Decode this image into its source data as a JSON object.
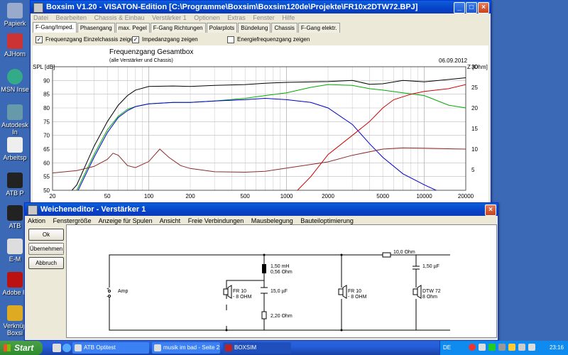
{
  "desktop": {
    "icons": [
      {
        "label": "Papierk"
      },
      {
        "label": "AJHorn"
      },
      {
        "label": "MSN Inse"
      },
      {
        "label": "Autodesk In"
      },
      {
        "label": "Arbeitsp"
      },
      {
        "label": "ATB P"
      },
      {
        "label": "ATB"
      },
      {
        "label": "E-M"
      },
      {
        "label": "Adobe R"
      },
      {
        "label": "Verknüp Boxsi"
      }
    ]
  },
  "boxsim": {
    "title": "Boxsim V1.20 - VISATON-Edition [C:\\Programme\\Boxsim\\Boxsim120de\\Projekte\\FR10x2DTW72.BPJ]",
    "menu": [
      "Datei",
      "Bearbeiten",
      "Chassis & Einbau",
      "Verstärker 1",
      "Optionen",
      "Extras",
      "Fenster",
      "Hilfe"
    ],
    "tabs": [
      "F-Gang/Imped.",
      "Phasengang",
      "max. Pegel",
      "F-Gang Richtungen",
      "Polarplots",
      "Bündelung",
      "Chassis",
      "F-Gang elektr."
    ],
    "active_tab": "F-Gang/Imped.",
    "checkboxes": [
      {
        "label": "Frequenzgang Einzelchassis zeigen",
        "checked": true
      },
      {
        "label": "Impedanzgang zeigen",
        "checked": true
      },
      {
        "label": "Energiefrequenzgang zeigen",
        "checked": false
      }
    ]
  },
  "chart_data": {
    "type": "line",
    "title": "Frequenzgang Gesamtbox",
    "subtitle": "(alle Verstärker und Chassis)",
    "date": "06.09.2012",
    "ylabel": "SPL [dB]",
    "y2label": "Z [Ohm]",
    "xscale": "log",
    "xlim": [
      20,
      20000
    ],
    "ylim": [
      50,
      95
    ],
    "y2lim": [
      0,
      30
    ],
    "xticks": [
      "20",
      "50",
      "100",
      "200",
      "500",
      "1000",
      "2000",
      "5000",
      "10000",
      "20000"
    ],
    "yticks": [
      "50",
      "55",
      "60",
      "65",
      "70",
      "75",
      "80",
      "85",
      "90"
    ],
    "y2ticks": [
      "5",
      "10",
      "15",
      "20",
      "25",
      "30"
    ],
    "grid": true,
    "series": [
      {
        "color": "#000000",
        "axis": "left",
        "points": [
          [
            20,
            42
          ],
          [
            30,
            52
          ],
          [
            40,
            66
          ],
          [
            50,
            75
          ],
          [
            60,
            81
          ],
          [
            70,
            84.5
          ],
          [
            80,
            86.5
          ],
          [
            100,
            87.8
          ],
          [
            150,
            88
          ],
          [
            200,
            87.8
          ],
          [
            300,
            88.2
          ],
          [
            500,
            88.5
          ],
          [
            700,
            89
          ],
          [
            1000,
            89.3
          ],
          [
            2000,
            89.6
          ],
          [
            3000,
            90
          ],
          [
            4000,
            88.6
          ],
          [
            5000,
            88.8
          ],
          [
            7000,
            90
          ],
          [
            10000,
            89.5
          ],
          [
            20000,
            91
          ]
        ]
      },
      {
        "color": "#00aa00",
        "axis": "left",
        "points": [
          [
            20,
            40
          ],
          [
            30,
            50
          ],
          [
            40,
            63
          ],
          [
            50,
            72
          ],
          [
            60,
            77
          ],
          [
            70,
            79.5
          ],
          [
            80,
            80.5
          ],
          [
            100,
            81.5
          ],
          [
            150,
            82
          ],
          [
            200,
            82
          ],
          [
            300,
            82.5
          ],
          [
            500,
            83.5
          ],
          [
            700,
            84.5
          ],
          [
            1000,
            85.5
          ],
          [
            1500,
            87.5
          ],
          [
            2000,
            88.5
          ],
          [
            3000,
            88.2
          ],
          [
            4000,
            87
          ],
          [
            5000,
            86.5
          ],
          [
            7000,
            85.5
          ],
          [
            10000,
            84.5
          ],
          [
            15000,
            81
          ],
          [
            20000,
            80
          ]
        ]
      },
      {
        "color": "#0000cc",
        "axis": "left",
        "points": [
          [
            20,
            38
          ],
          [
            30,
            49
          ],
          [
            40,
            62
          ],
          [
            50,
            71
          ],
          [
            60,
            76.5
          ],
          [
            70,
            79
          ],
          [
            80,
            80.5
          ],
          [
            100,
            81.5
          ],
          [
            150,
            82
          ],
          [
            200,
            82
          ],
          [
            300,
            82.5
          ],
          [
            500,
            83
          ],
          [
            700,
            83.5
          ],
          [
            1000,
            83
          ],
          [
            1500,
            82
          ],
          [
            2000,
            80
          ],
          [
            3000,
            74
          ],
          [
            4000,
            67
          ],
          [
            5000,
            62
          ],
          [
            7000,
            56
          ],
          [
            10000,
            52
          ],
          [
            20000,
            45
          ]
        ]
      },
      {
        "color": "#cc0000",
        "axis": "left",
        "points": [
          [
            1200,
            50
          ],
          [
            1500,
            55
          ],
          [
            2000,
            63
          ],
          [
            3000,
            70
          ],
          [
            4000,
            75
          ],
          [
            5000,
            80
          ],
          [
            6000,
            83
          ],
          [
            8000,
            85
          ],
          [
            10000,
            86
          ],
          [
            15000,
            87
          ],
          [
            20000,
            88.5
          ]
        ]
      },
      {
        "color": "#8b2a2a",
        "axis": "right",
        "points": [
          [
            20,
            4.2
          ],
          [
            30,
            4.8
          ],
          [
            40,
            5.8
          ],
          [
            50,
            7.5
          ],
          [
            55,
            9
          ],
          [
            60,
            8.5
          ],
          [
            70,
            6
          ],
          [
            80,
            5.5
          ],
          [
            100,
            7
          ],
          [
            120,
            10
          ],
          [
            140,
            8
          ],
          [
            170,
            6
          ],
          [
            200,
            5.3
          ],
          [
            300,
            4.5
          ],
          [
            500,
            4.4
          ],
          [
            700,
            4.6
          ],
          [
            1000,
            5.4
          ],
          [
            2000,
            6.9
          ],
          [
            3000,
            8.5
          ],
          [
            5000,
            10
          ],
          [
            7000,
            10.3
          ],
          [
            10000,
            10.2
          ],
          [
            20000,
            10
          ]
        ]
      }
    ]
  },
  "weichen": {
    "title": "Weicheneditor - Verstärker 1",
    "menu": [
      "Aktion",
      "Fenstergröße",
      "Anzeige für Spulen",
      "Ansicht",
      "Freie Verbindungen",
      "Mausbelegung",
      "Bauteiloptimierung"
    ],
    "buttons": {
      "ok": "Ok",
      "apply": "Übernehmen",
      "cancel": "Abbruch"
    },
    "schematic": {
      "amp": "Amp",
      "plus": "+",
      "minus": "-",
      "coil": [
        "1,50 mH",
        "0,56 Ohm"
      ],
      "cap_low": "15,0 µF",
      "res_low": "2,20 Ohm",
      "fr10_a": [
        "FR 10",
        "- 8 OHM"
      ],
      "fr10_b": [
        "FR 10",
        "- 8 OHM"
      ],
      "res_high": "10,0 Ohm",
      "cap_high": "1,50 µF",
      "dtw": [
        "DTW 72",
        "8 Ohm"
      ]
    }
  },
  "taskbar": {
    "start": "Start",
    "tasks": [
      "ATB Optitest",
      "musik im bad - Seite 2...",
      "BOXSIM"
    ],
    "lang": "DE",
    "clock": "23:16"
  }
}
